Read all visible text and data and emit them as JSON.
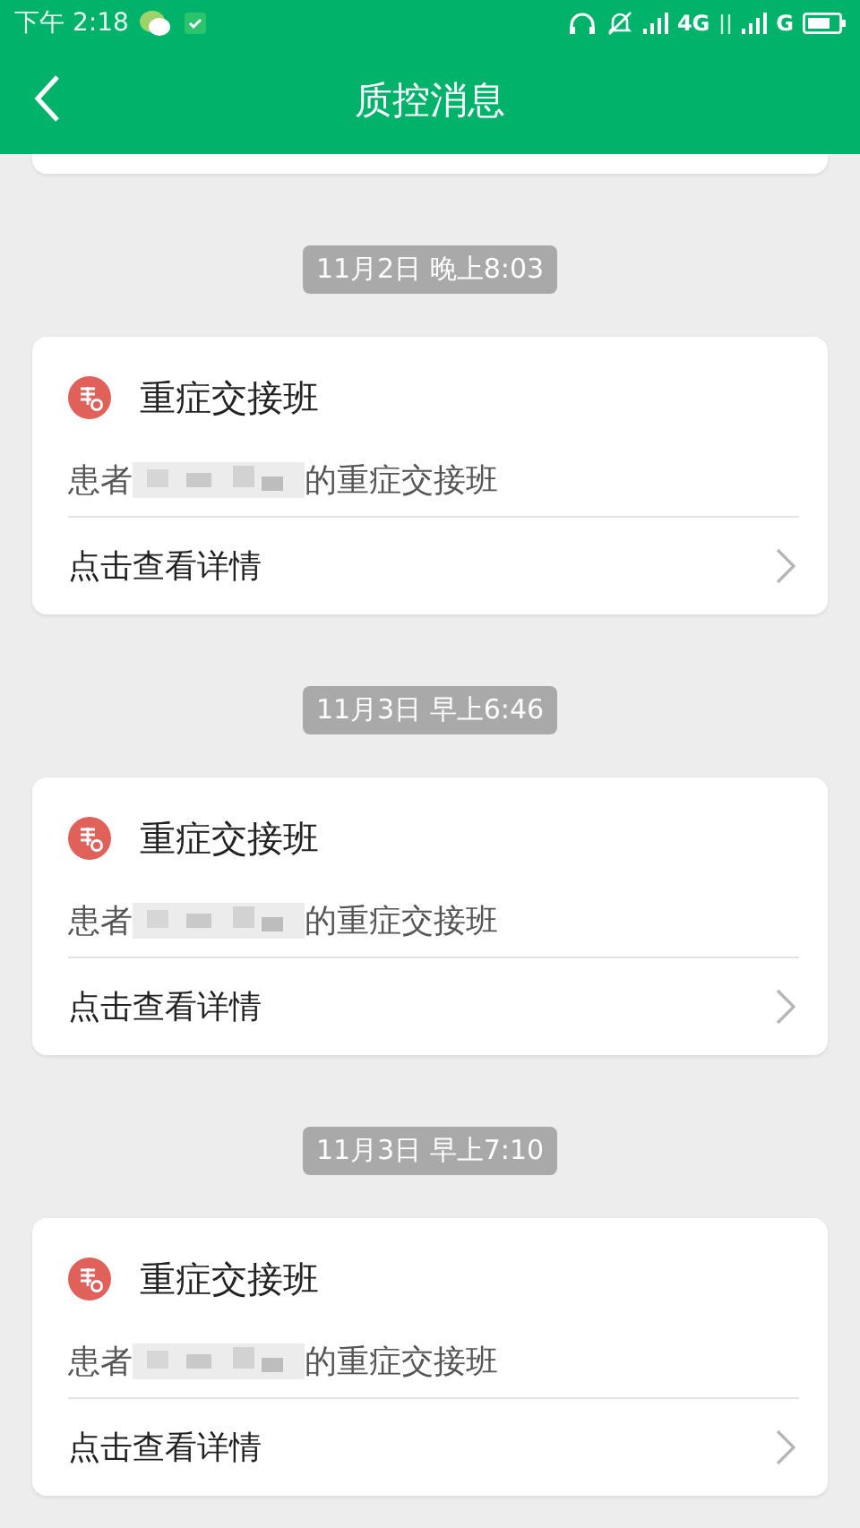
{
  "status_bar": {
    "time": "下午 2:18",
    "network_1": "4G",
    "network_2": "G"
  },
  "header": {
    "title": "质控消息"
  },
  "messages": [
    {
      "time": "11月2日 晚上8:03",
      "title": "重症交接班",
      "message_prefix": "患者",
      "message_suffix": "的重症交接班",
      "action": "点击查看详情"
    },
    {
      "time": "11月3日 早上6:46",
      "title": "重症交接班",
      "message_prefix": "患者",
      "message_suffix": "的重症交接班",
      "action": "点击查看详情"
    },
    {
      "time": "11月3日 早上7:10",
      "title": "重症交接班",
      "message_prefix": "患者",
      "message_suffix": "的重症交接班",
      "action": "点击查看详情"
    }
  ]
}
